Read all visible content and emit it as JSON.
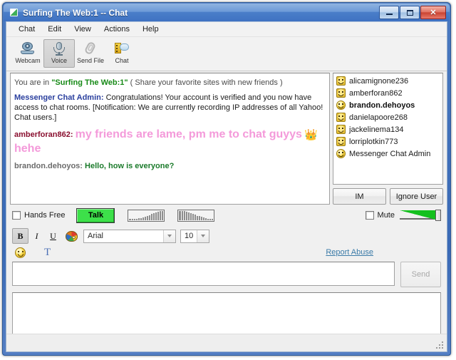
{
  "window": {
    "title": "Surfing The Web:1 -- Chat",
    "app_icon": "chat-window-icon",
    "buttons": {
      "minimize": "minimize-icon",
      "maximize": "maximize-icon",
      "close": "✕"
    }
  },
  "menubar": {
    "items": [
      {
        "label": "Chat"
      },
      {
        "label": "Edit"
      },
      {
        "label": "View"
      },
      {
        "label": "Actions"
      },
      {
        "label": "Help"
      }
    ]
  },
  "toolbar": {
    "buttons": [
      {
        "label": "Webcam",
        "icon": "webcam-icon",
        "pressed": false
      },
      {
        "label": "Voice",
        "icon": "microphone-icon",
        "pressed": true
      },
      {
        "label": "Send File",
        "icon": "paperclip-icon",
        "pressed": false
      },
      {
        "label": "Chat",
        "icon": "chat-door-icon",
        "pressed": false
      }
    ]
  },
  "chat": {
    "system_line": {
      "prefix": "You are in ",
      "room": "\"Surfing The Web:1\"",
      "suffix": " ( Share your favorite sites with new friends )"
    },
    "messages": [
      {
        "nick": "Messenger Chat Admin:",
        "body": "Congratulations! Your account is verified and you now have access to chat rooms. [Notification: We are currently recording IP addresses of all Yahoo! Chat users.]",
        "style": "admin"
      },
      {
        "nick": "amberforan862:",
        "body_part1": "my friends are lame, pm me to chat guyys",
        "emoji": "👑",
        "body_part2": "hehe",
        "style": "amber"
      },
      {
        "nick": "brandon.dehoyos:",
        "body": "Hello, how is everyone?",
        "style": "brandon"
      }
    ]
  },
  "userlist": {
    "users": [
      {
        "name": "alicamignone236",
        "icon": "user-face-icon",
        "highlighted": false
      },
      {
        "name": "amberforan862",
        "icon": "user-face-icon",
        "highlighted": false
      },
      {
        "name": "brandon.dehoyos",
        "icon": "self-face-icon",
        "highlighted": true
      },
      {
        "name": "danielapoore268",
        "icon": "user-face-icon",
        "highlighted": false
      },
      {
        "name": "jackelinema134",
        "icon": "user-face-icon",
        "highlighted": false
      },
      {
        "name": "lorriplotkin773",
        "icon": "user-face-icon",
        "highlighted": false
      },
      {
        "name": "Messenger Chat Admin",
        "icon": "admin-face-icon",
        "highlighted": false
      }
    ],
    "buttons": {
      "im": "IM",
      "ignore": "Ignore User"
    }
  },
  "voicebar": {
    "hands_free_label": "Hands Free",
    "hands_free_checked": false,
    "talk_label": "Talk",
    "talk_color": "#3de04a",
    "mute_label": "Mute",
    "mute_checked": false,
    "meter_left": "vu-meter-ramp-up",
    "meter_right": "vu-meter-ramp-down",
    "volume_level": "max"
  },
  "formatbar": {
    "bold": "B",
    "bold_active": true,
    "italic": "I",
    "underline": "U",
    "color_icon": "color-palette-icon",
    "font_value": "Arial",
    "size_value": "10"
  },
  "emojirow": {
    "smiley_icon": "smiley-face-icon",
    "text_tool": "T",
    "report_abuse": "Report Abuse"
  },
  "input": {
    "message_value": "",
    "message_placeholder": "",
    "send_label": "Send",
    "send_disabled": true
  },
  "bottom": {
    "panel_value": "",
    "resize_grip": "resize-grip-icon"
  }
}
